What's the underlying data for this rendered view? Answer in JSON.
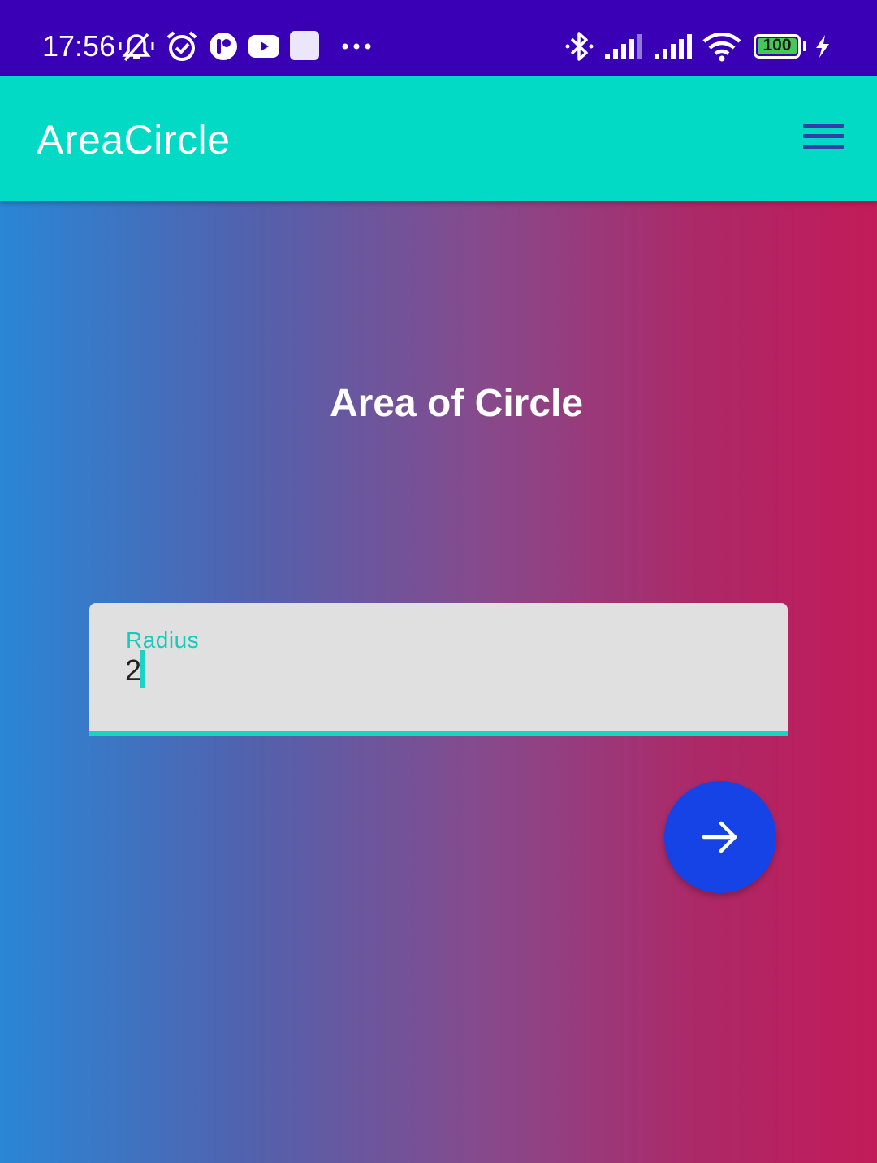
{
  "status_bar": {
    "time": "17:56",
    "battery_level": "100",
    "icons": [
      "muted-vibrate-icon",
      "alarm-icon",
      "app-notification-icon",
      "youtube-icon",
      "app-square-icon",
      "more-dots-icon",
      "bluetooth-icon",
      "signal-icon",
      "signal-icon",
      "wifi-icon",
      "battery-icon",
      "charging-icon"
    ]
  },
  "app_bar": {
    "title": "AreaCircle",
    "menu_icon": "hamburger-menu-icon"
  },
  "main": {
    "heading": "Area of Circle",
    "radius_field": {
      "label": "Radius",
      "value": "2"
    },
    "submit_icon": "arrow-right-icon"
  },
  "colors": {
    "status_bar_bg": "#3a00b6",
    "app_bar_bg": "#02dac6",
    "accent": "#1bd3c4",
    "fab_bg": "#1543e6",
    "gradient_left": "#2a86d6",
    "gradient_right": "#c31b59"
  }
}
